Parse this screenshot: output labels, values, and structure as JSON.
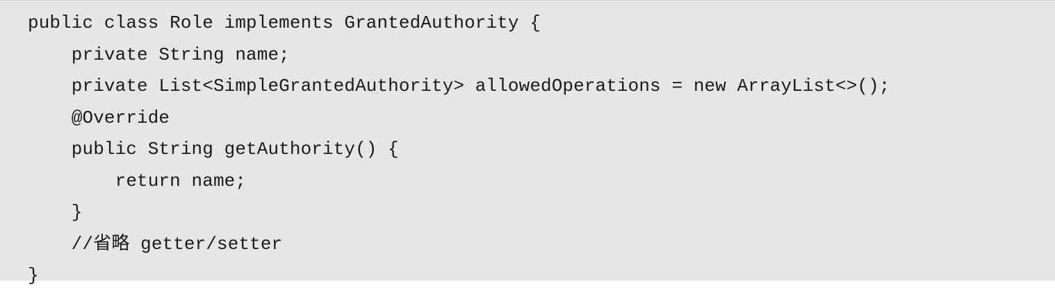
{
  "code": {
    "lines": [
      "public class Role implements GrantedAuthority {",
      "    private String name;",
      "    private List<SimpleGrantedAuthority> allowedOperations = new ArrayList<>();",
      "    @Override",
      "    public String getAuthority() {",
      "        return name;",
      "    }",
      "    //省略 getter/setter",
      "}"
    ]
  }
}
